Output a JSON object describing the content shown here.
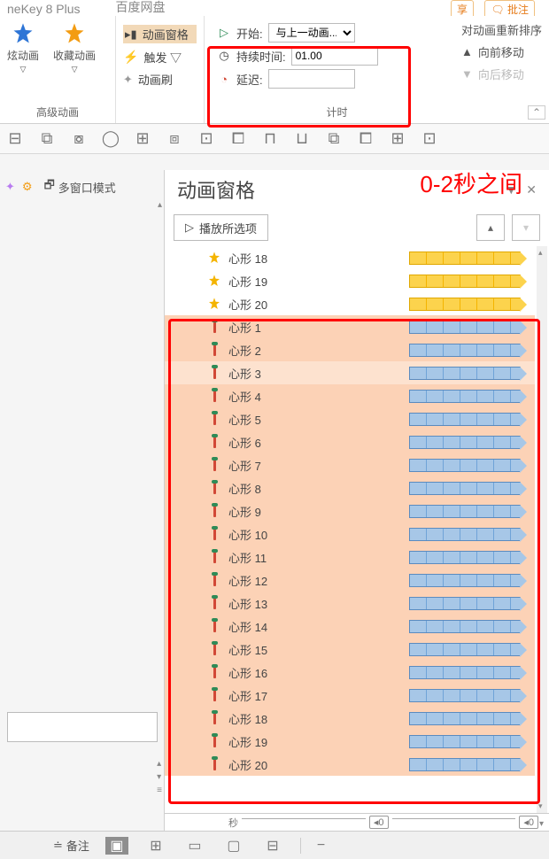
{
  "titlebar": {
    "app": "neKey 8 Plus",
    "other": "百度网盘",
    "share": "享",
    "annotate": "批注"
  },
  "ribbon": {
    "adv": {
      "dazzle": "炫动画",
      "dazzle_drop": "▽",
      "fav": "收藏动画",
      "fav_drop": "▽",
      "label": "高级动画"
    },
    "keys": {
      "pane": "动画窗格",
      "trigger": "触发 ▽",
      "brush": "动画刷"
    },
    "timing": {
      "start": "开始:",
      "start_val": "与上一动画...",
      "duration": "持续时间:",
      "duration_val": "01.00",
      "delay": "延迟:",
      "delay_val": "",
      "label": "计时"
    },
    "reorder": {
      "title": "对动画重新排序",
      "fwd": "向前移动",
      "back": "向后移动"
    }
  },
  "leftbar": {
    "multiwin": "多窗口模式"
  },
  "pane": {
    "title": "动画窗格",
    "annotation": "0-2秒之间",
    "play": "播放所选项",
    "seconds_label": "秒",
    "zero": "0"
  },
  "items": [
    {
      "name": "心形 18",
      "type": "star",
      "bar": "yellow",
      "cls": ""
    },
    {
      "name": "心形 19",
      "type": "star",
      "bar": "yellow",
      "cls": ""
    },
    {
      "name": "心形 20",
      "type": "star",
      "bar": "yellow",
      "cls": ""
    },
    {
      "name": "心形 1",
      "type": "line",
      "bar": "blue",
      "cls": "salmon"
    },
    {
      "name": "心形 2",
      "type": "line",
      "bar": "blue",
      "cls": "salmon"
    },
    {
      "name": "心形 3",
      "type": "line",
      "bar": "blue",
      "cls": "salmon sel"
    },
    {
      "name": "心形 4",
      "type": "line",
      "bar": "blue",
      "cls": "salmon"
    },
    {
      "name": "心形 5",
      "type": "line",
      "bar": "blue",
      "cls": "salmon"
    },
    {
      "name": "心形 6",
      "type": "line",
      "bar": "blue",
      "cls": "salmon"
    },
    {
      "name": "心形 7",
      "type": "line",
      "bar": "blue",
      "cls": "salmon"
    },
    {
      "name": "心形 8",
      "type": "line",
      "bar": "blue",
      "cls": "salmon"
    },
    {
      "name": "心形 9",
      "type": "line",
      "bar": "blue",
      "cls": "salmon"
    },
    {
      "name": "心形 10",
      "type": "line",
      "bar": "blue",
      "cls": "salmon"
    },
    {
      "name": "心形 11",
      "type": "line",
      "bar": "blue",
      "cls": "salmon"
    },
    {
      "name": "心形 12",
      "type": "line",
      "bar": "blue",
      "cls": "salmon"
    },
    {
      "name": "心形 13",
      "type": "line",
      "bar": "blue",
      "cls": "salmon"
    },
    {
      "name": "心形 14",
      "type": "line",
      "bar": "blue",
      "cls": "salmon"
    },
    {
      "name": "心形 15",
      "type": "line",
      "bar": "blue",
      "cls": "salmon"
    },
    {
      "name": "心形 16",
      "type": "line",
      "bar": "blue",
      "cls": "salmon"
    },
    {
      "name": "心形 17",
      "type": "line",
      "bar": "blue",
      "cls": "salmon"
    },
    {
      "name": "心形 18",
      "type": "line",
      "bar": "blue",
      "cls": "salmon"
    },
    {
      "name": "心形 19",
      "type": "line",
      "bar": "blue",
      "cls": "salmon"
    },
    {
      "name": "心形 20",
      "type": "line",
      "bar": "blue",
      "cls": "salmon"
    }
  ],
  "status": {
    "notes": "备注"
  }
}
